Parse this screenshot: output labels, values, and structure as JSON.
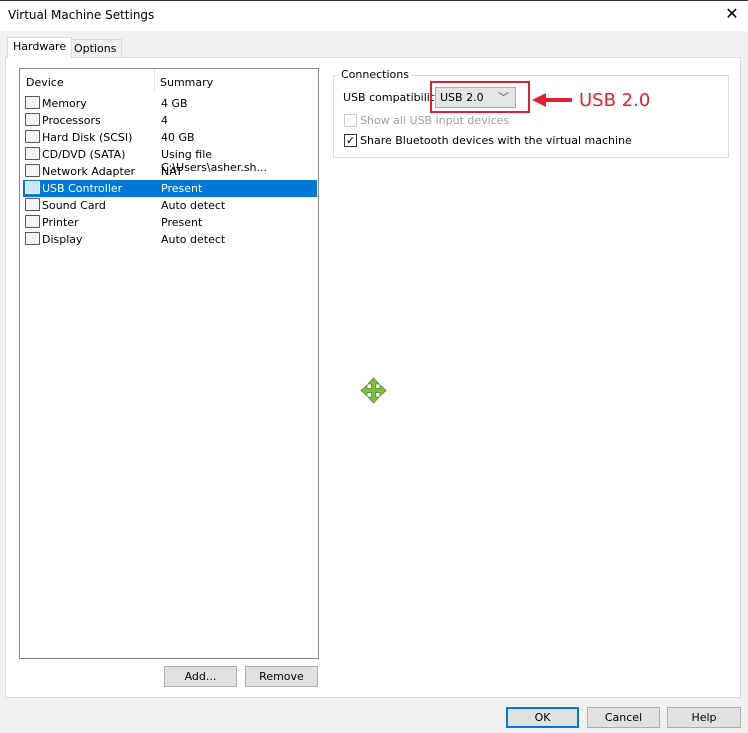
{
  "window": {
    "title": "Virtual Machine Settings",
    "close_icon": "close-icon"
  },
  "tabs": [
    {
      "label": "Hardware",
      "active": true
    },
    {
      "label": "Options",
      "active": false
    }
  ],
  "device_list": {
    "columns": [
      "Device",
      "Summary"
    ],
    "rows": [
      {
        "device": "Memory",
        "summary": "4 GB",
        "icon": "memory-icon"
      },
      {
        "device": "Processors",
        "summary": "4",
        "icon": "processor-icon"
      },
      {
        "device": "Hard Disk (SCSI)",
        "summary": "40 GB",
        "icon": "hard-disk-icon"
      },
      {
        "device": "CD/DVD (SATA)",
        "summary": "Using file C:\\Users\\asher.sh...",
        "icon": "cd-dvd-icon"
      },
      {
        "device": "Network Adapter",
        "summary": "NAT",
        "icon": "network-adapter-icon"
      },
      {
        "device": "USB Controller",
        "summary": "Present",
        "icon": "usb-icon",
        "selected": true
      },
      {
        "device": "Sound Card",
        "summary": "Auto detect",
        "icon": "speaker-icon"
      },
      {
        "device": "Printer",
        "summary": "Present",
        "icon": "printer-icon"
      },
      {
        "device": "Display",
        "summary": "Auto detect",
        "icon": "monitor-icon"
      }
    ],
    "add_label": "Add...",
    "remove_label": "Remove"
  },
  "connections": {
    "group_label": "Connections",
    "usb_compat_label": "USB compatibility:",
    "usb_compat_value": "USB 2.0",
    "show_all_usb_label": "Show all USB input devices",
    "show_all_usb_checked": false,
    "show_all_usb_enabled": false,
    "share_bluetooth_label": "Share Bluetooth devices with the virtual machine",
    "share_bluetooth_checked": true
  },
  "annotation": {
    "text": "USB 2.0",
    "color": "#e5202e"
  },
  "footer": {
    "ok": "OK",
    "cancel": "Cancel",
    "help": "Help"
  },
  "colors": {
    "selection": "#0078d7",
    "move_cursor": "#7cc242"
  }
}
